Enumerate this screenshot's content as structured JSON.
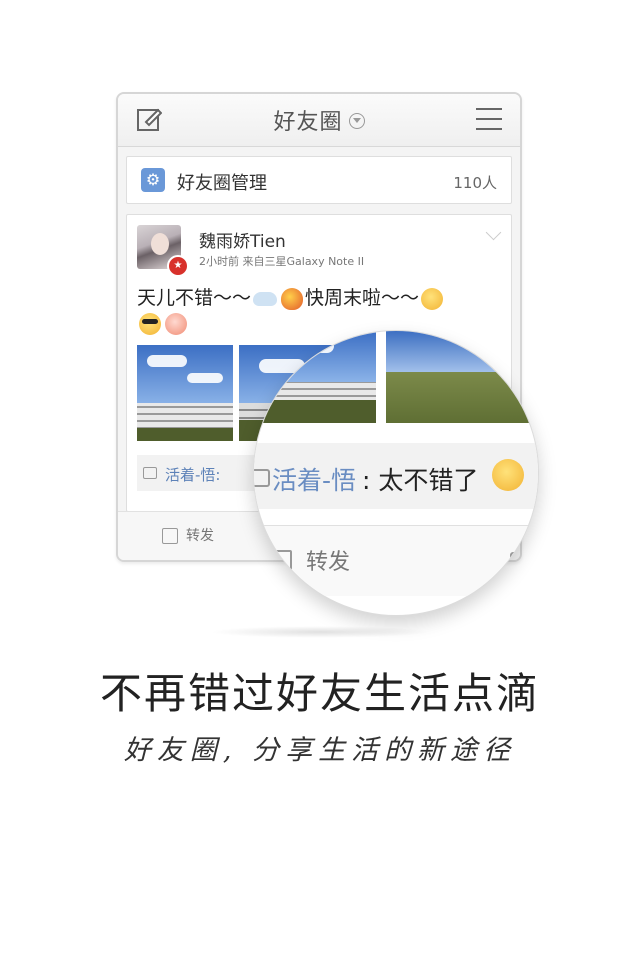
{
  "topbar": {
    "title": "好友圈"
  },
  "manager": {
    "label": "好友圈管理",
    "count": "110人"
  },
  "post": {
    "author": "魏雨娇Tien",
    "meta": "2小时前  来自三星Galaxy Note II",
    "text_part1": "天儿不错～～",
    "text_part2": "快周末啦～～",
    "comment_name": "活着-悟:"
  },
  "actions": {
    "forward": "转发"
  },
  "magnifier": {
    "comment_name": "活着-悟",
    "comment_text": ": 太不错了",
    "forward": "转发"
  },
  "promo": {
    "headline": "不再错过好友生活点滴",
    "subline": "好友圈, 分享生活的新途径"
  },
  "colors": {
    "link": "#5d82b8",
    "gear": "#6a98d8",
    "badge": "#d8312b"
  }
}
